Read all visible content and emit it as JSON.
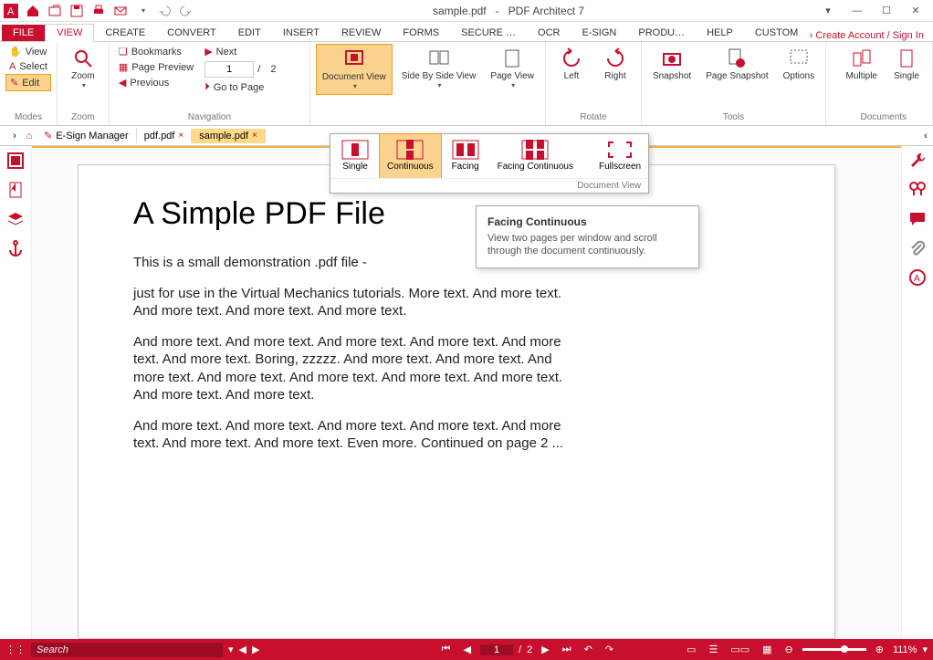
{
  "title": {
    "doc": "sample.pdf",
    "sep": "-",
    "app": "PDF Architect 7"
  },
  "account_link": "›  Create Account / Sign In",
  "tabs": {
    "file": "FILE",
    "items": [
      "VIEW",
      "CREATE",
      "CONVERT",
      "EDIT",
      "INSERT",
      "REVIEW",
      "FORMS",
      "SECURE …",
      "OCR",
      "E-SIGN",
      "PRODU…",
      "HELP",
      "CUSTOM"
    ],
    "active": "VIEW"
  },
  "ribbon": {
    "modes": {
      "label": "Modes",
      "view": "View",
      "select": "Select",
      "edit": "Edit"
    },
    "zoom": {
      "label": "Zoom",
      "btn": "Zoom"
    },
    "nav": {
      "label": "Navigation",
      "bookmarks": "Bookmarks",
      "next": "Next",
      "preview": "Page Preview",
      "previous": "Previous",
      "goto": "Go to Page",
      "page_current": "1",
      "page_sep": "/",
      "page_total": "2"
    },
    "docview": {
      "label": "Document View"
    },
    "sidebyside": {
      "label": "Side By Side View"
    },
    "pageview": {
      "label": "Page View"
    },
    "rotate": {
      "label": "Rotate",
      "left": "Left",
      "right": "Right"
    },
    "tools": {
      "label": "Tools",
      "snapshot": "Snapshot",
      "page_snapshot": "Page Snapshot",
      "options": "Options"
    },
    "documents": {
      "label": "Documents",
      "multiple": "Multiple",
      "single": "Single"
    }
  },
  "gallery": {
    "title": "Document View",
    "single": "Single",
    "continuous": "Continuous",
    "facing": "Facing",
    "facing_continuous": "Facing Continuous",
    "fullscreen": "Fullscreen"
  },
  "tooltip": {
    "title": "Facing Continuous",
    "body": "View two pages per window and scroll through the document continuously."
  },
  "doctabs": {
    "esign": "E-Sign Manager",
    "pdf": "pdf.pdf",
    "sample": "sample.pdf"
  },
  "document": {
    "heading": "A Simple PDF File",
    "p1": "This is a small demonstration .pdf file -",
    "p2": "just for use in the Virtual Mechanics tutorials. More text. And more text. And more text. And more text. And more text.",
    "p3": "And more text. And more text. And more text. And more text. And more text. And more text. Boring, zzzzz. And more text. And more text. And more text. And more text. And more text. And more text. And more text. And more text. And more text.",
    "p4": "And more text. And more text. And more text. And more text. And more text. And more text. And more text. Even more. Continued on page 2 ..."
  },
  "status": {
    "search_placeholder": "Search",
    "page_current": "1",
    "page_sep": "/",
    "page_total": "2",
    "zoom": "111%"
  }
}
